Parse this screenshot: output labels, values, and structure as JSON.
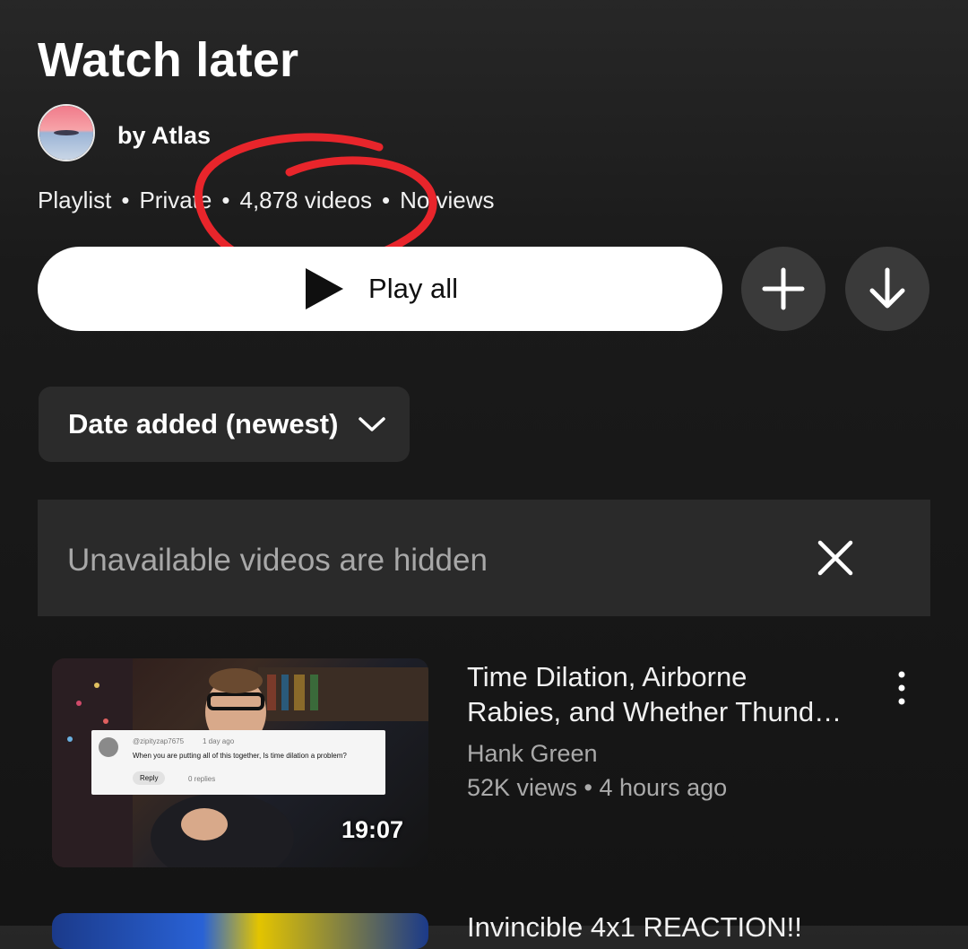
{
  "playlist": {
    "title": "Watch later",
    "owner": "by Atlas",
    "meta": [
      "Playlist",
      "Private",
      "4,878 videos",
      "No views"
    ],
    "separator": "•"
  },
  "actions": {
    "play_all_label": "Play all",
    "add_icon": "plus-icon",
    "download_icon": "download-arrow-icon"
  },
  "sort": {
    "selected": "Date added (newest)"
  },
  "notice": {
    "text": "Unavailable videos are hidden",
    "close_icon": "close-icon"
  },
  "videos": [
    {
      "title_line1": "Time Dilation, Airborne",
      "title_line2": "Rabies, and Whether Thund…",
      "channel": "Hank Green",
      "stats": "52K views • 4 hours ago",
      "duration": "19:07",
      "thumbnail_comment": {
        "handle": "@zipityzap7675",
        "time": "1 day ago",
        "text": "When you are putting all of this together, Is time dilation a problem?",
        "reply": "Reply",
        "replies": "0 replies"
      }
    },
    {
      "title_line1": "Invincible 4x1 REACTION!!"
    }
  ],
  "colors": {
    "annotation": "#e8252b",
    "background": "#141414",
    "chip": "#2b2b2b",
    "secondary_text": "#aaaaaa"
  }
}
